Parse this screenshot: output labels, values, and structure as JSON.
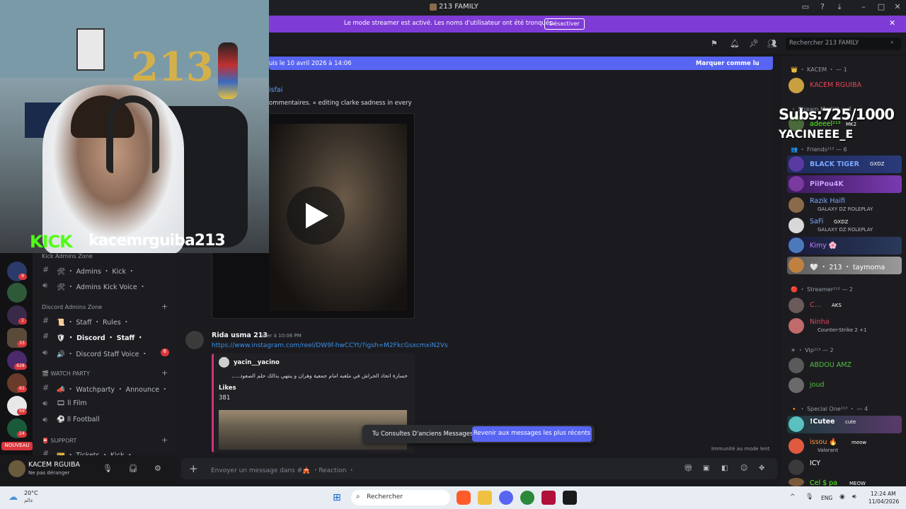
{
  "window": {
    "title": "213 FAMILY"
  },
  "banner": {
    "text": "Le mode streamer est activé. Les noms d'utilisateur ont été tronqués.",
    "button": "Désactiver",
    "close": "✕"
  },
  "header": {
    "search_placeholder": "Rechercher 213 FAMILY"
  },
  "newbar": {
    "text": "uis le 10 avril 2026 à 14:06",
    "mark": "Marquer comme lu"
  },
  "messages": {
    "frag_name": "isfai",
    "frag_text": "ommentaires. « editing clarke sadness in every",
    "msg": {
      "author": "Rida usma 213",
      "time": "Hier à 10:06 PM",
      "link": "https://www.instagram.com/reel/DW9f-hwCCYt/?igsh=M2FkcGsxcmxiN2Vs",
      "embed": {
        "author": "yacin__yacino",
        "text": "خسارة اتحاد الحراش في ملعبه امام جمعية وهران و ينتهي بذالك حلم الصعود.....",
        "likes_label": "Likes",
        "likes_value": "381"
      }
    },
    "old_notice": "Tu Consultes D'anciens Messages",
    "old_button": "Revenir aux messages les plus récents",
    "slowmode": "Immunité au mode lent"
  },
  "composer": {
    "placeholder": "Envoyer un message dans #🎪 ・Reaction ・"
  },
  "channels": {
    "cat_kick": "Kick Admins Zone",
    "ch_admins_kick": "🛠 ・ Admins ・ Kick ・",
    "ch_admins_kick_voice": "🛠 ・ Admins Kick Voice ・",
    "cat_discord": "Discord Admins Zone",
    "ch_staff_rules": "📜 ・ Staff ・ Rules ・",
    "ch_discord_staff": "🛡 ・ Discord ・ Staff ・",
    "ch_discord_staff_voice": "🔊 ・ Discord Staff Voice ・",
    "ch_discord_staff_voice_badge": "6",
    "cat_watch": "🎬 WATCH PARTY",
    "ch_watchparty": "📣 ・ Watchparty ・ Announce ・",
    "ch_film": "🎞 ll Film",
    "ch_football": "⚽ ll Football",
    "cat_support": "📮 SUPPORT",
    "ch_tickets": "🎫 ・ Tickets ・ Kick ・"
  },
  "guilds": {
    "badges": [
      "9",
      "1",
      "33",
      "628",
      "61",
      "69",
      "24"
    ],
    "new_label": "NOUVEAU"
  },
  "user": {
    "name": "KACEM RGUIBA",
    "status": "Ne pas déranger"
  },
  "members": {
    "cat_kacem": "👑 ・ KACEM ・ — 1",
    "m_kacem": "KACEM RGUIBA",
    "cat_streammod": "・ Stream Mod²¹³ — 1",
    "m_adeeel": "adeeel²¹³",
    "m_adeeel_tag": "MK2",
    "cat_friends": "👥 ・ Friends²¹³ — 6",
    "m_blacktiger": "BLACK TIGER",
    "m_blacktiger_tag": "GXDZ",
    "m_piipou": "PiiPou4K",
    "m_razik": "Razik Haifi",
    "m_razik_sub": "GALAXY DZ ROLEPLAY",
    "m_safi": "SaFi",
    "m_safi_tag": "GXDZ",
    "m_safi_sub": "GALAXY DZ ROLEPLAY",
    "m_kimy": "Kimy 🌸",
    "m_taymoma": "🤍 ・ 213 ・ taymoma",
    "cat_streamer": "🔴 ・ Streamer²¹³ — 2",
    "m_c": "C...",
    "m_c_tag": "AKS",
    "m_ninha": "Ninha",
    "m_ninha_sub": "Counter-Strike 2 +1",
    "cat_vip": "☀ ・ Vip²¹³ — 2",
    "m_abdou": "ABDOU AMZ",
    "m_joud": "joud",
    "cat_specialone": "🔸 ・ Special One²¹³ ・ — 4",
    "m_cutee": "!Cutee",
    "m_cutee_tag": "cute",
    "m_issou": "issou 🔥",
    "m_issou_tag": "meow",
    "m_issou_sub": "Valorant",
    "m_icy": "ICY",
    "m_last": "Cel $ pa",
    "m_last_tag": "MEOW"
  },
  "overlay": {
    "brand": "KICK",
    "handle": "kacemrguiba213",
    "number": "213",
    "subs": "Subs:725/1000",
    "subs_user": "YACINEEE_E"
  },
  "taskbar": {
    "temp": "20°C",
    "weather": "عالم",
    "search": "Rechercher",
    "lang": "ENG",
    "time": "12:24 AM",
    "date": "11/04/2026"
  }
}
